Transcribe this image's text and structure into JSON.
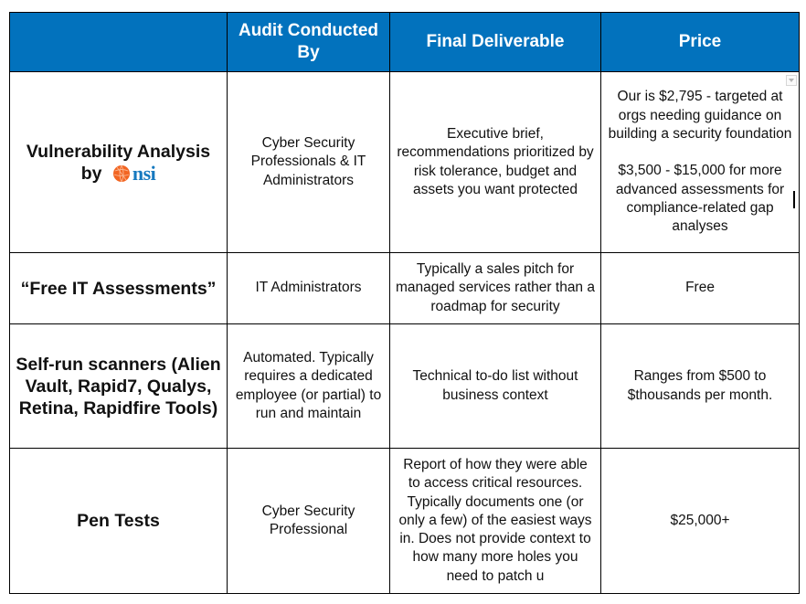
{
  "table": {
    "header": {
      "service": "",
      "conducted_by": "Audit Conducted By",
      "deliverable": "Final Deliverable",
      "price": "Price"
    },
    "colors": {
      "header_bg": "#0272bd",
      "header_text": "#ffffff",
      "logo_orange": "#f26522",
      "logo_blue": "#1679bf"
    },
    "rows": [
      {
        "service": "Vulnerability Analysis",
        "service_by": "by",
        "logo_text": "nsi",
        "logo_icon": "globe-icon",
        "conducted_by": "Cyber Security Professionals & IT Administrators",
        "deliverable": "Executive brief, recommendations prioritized by risk tolerance, budget and assets you want protected",
        "price_lines": [
          "Our is $2,795 - targeted at orgs needing guidance on building a security foundation",
          "$3,500 - $15,000 for more advanced assessments for compliance-related gap analyses"
        ]
      },
      {
        "service": "“Free IT Assessments”",
        "conducted_by": "IT Administrators",
        "deliverable": "Typically a sales pitch for managed services rather than a roadmap for security",
        "price": "Free"
      },
      {
        "service": "Self-run scanners (Alien Vault, Rapid7, Qualys, Retina, Rapidfire Tools)",
        "conducted_by": "Automated. Typically requires a dedicated employee (or partial) to run and maintain",
        "deliverable": "Technical to-do list without business context",
        "price": "Ranges from $500 to $thousands per month."
      },
      {
        "service": "Pen Tests",
        "conducted_by": "Cyber Security Professional",
        "deliverable": "Report of how they were able to access critical resources. Typically documents one (or only a few) of the easiest ways in. Does not provide context to how many more holes you need to patch u",
        "price": "$25,000+"
      }
    ]
  }
}
